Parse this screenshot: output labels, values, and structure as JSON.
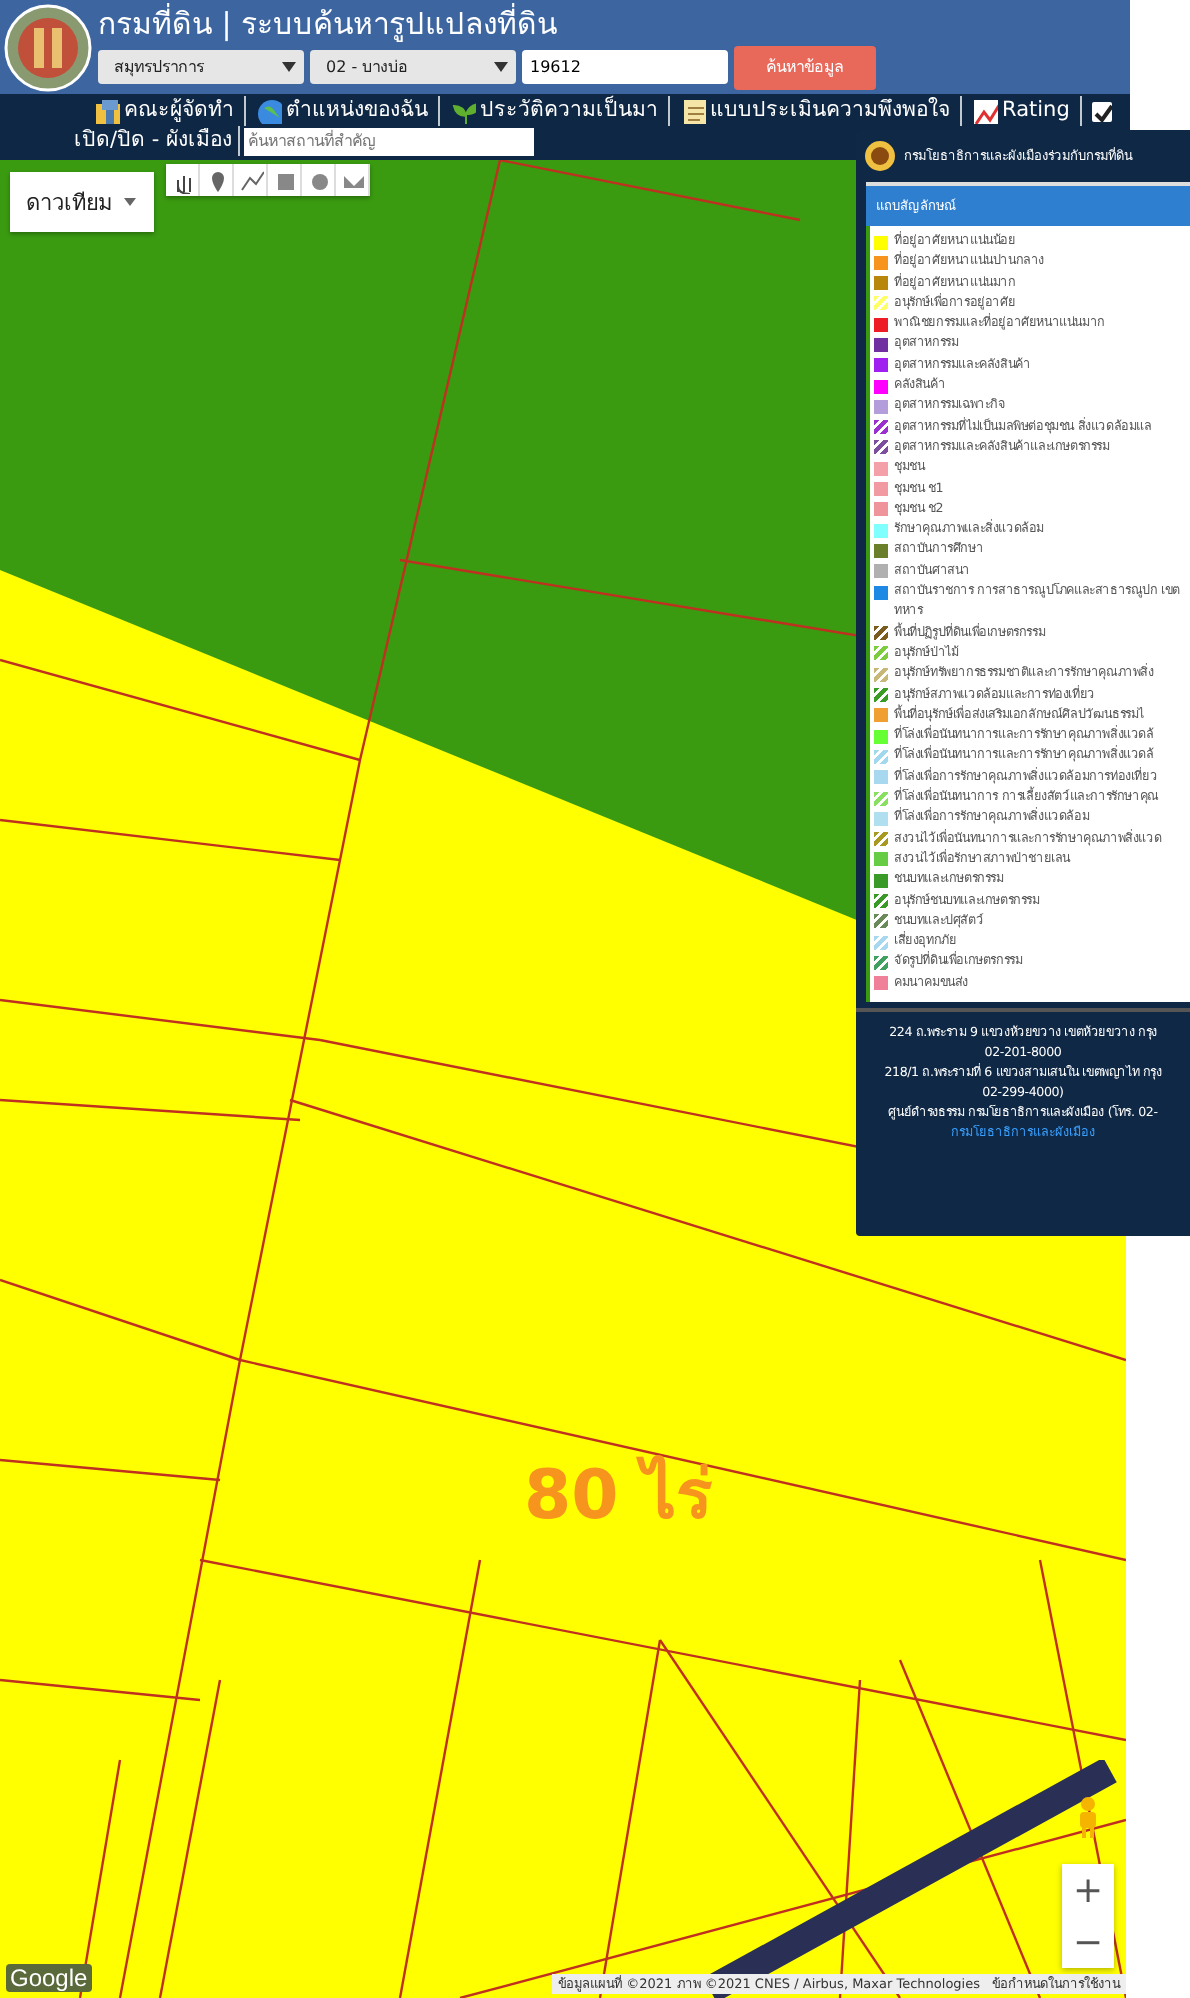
{
  "header": {
    "title": "กรมที่ดิน | ระบบค้นหารูปแปลงที่ดิน",
    "province_select": "สมุทรปราการ",
    "district_select": "02 - บางบ่อ",
    "parcel_input": "19612",
    "search_button": "ค้นหาข้อมูล"
  },
  "nav": {
    "items": [
      {
        "label": "คณะผู้จัดทำ",
        "kind": "people"
      },
      {
        "label": "ตำแหน่งของฉัน",
        "kind": "globe"
      },
      {
        "label": "ประวัติความเป็นมา",
        "kind": "sprout"
      },
      {
        "label": "แบบประเมินความพึงพอใจ",
        "kind": "note"
      },
      {
        "label": "Rating",
        "kind": "chart"
      }
    ],
    "toggle": {
      "label": "เปิด/ปิด - ผังเมือง",
      "checked": true
    },
    "place_search": {
      "placeholder": "ค้นหาสถานที่สำคัญ"
    }
  },
  "map": {
    "map_type": "ดาวเทียม",
    "area_label": "80 ไร่",
    "google_logo": "Google",
    "attribution": "ข้อมูลแผนที่ ©2021 ภาพ ©2021 CNES / Airbus, Maxar Technologies",
    "terms": "ข้อกำหนดในการใช้งาน",
    "zoom_in": "+",
    "zoom_out": "−"
  },
  "legend": {
    "title": "กรมโยธาธิการและผังเมืองร่วมกับกรมที่ดิน",
    "heading": "แถบสัญลักษณ์",
    "items": [
      {
        "label": "ที่อยู่อาศัยหนาแน่นน้อย",
        "color": "#ffff00",
        "kind": "solid"
      },
      {
        "label": "ที่อยู่อาศัยหนาแน่นปานกลาง",
        "color": "#f7941d",
        "kind": "solid"
      },
      {
        "label": "ที่อยู่อาศัยหนาแน่นมาก",
        "color": "#b8860b",
        "kind": "solid"
      },
      {
        "label": "อนุรักษ์เพื่อการอยู่อาศัย",
        "color": "#ffff66",
        "kind": "hatched"
      },
      {
        "label": "พาณิชยกรรมและที่อยู่อาศัยหนาแน่นมาก",
        "color": "#ee1c25",
        "kind": "solid"
      },
      {
        "label": "อุตสาหกรรม",
        "color": "#7030a0",
        "kind": "solid"
      },
      {
        "label": "อุตสาหกรรมและคลังสินค้า",
        "color": "#a020f0",
        "kind": "solid"
      },
      {
        "label": "คลังสินค้า",
        "color": "#ff00ff",
        "kind": "solid"
      },
      {
        "label": "อุตสาหกรรมเฉพาะกิจ",
        "color": "#b39ddb",
        "kind": "solid"
      },
      {
        "label": "อุตสาหกรรมที่ไม่เป็นมลพิษต่อชุมชน สิ่งแวดล้อมแล",
        "color": "#9b30d0",
        "kind": "hatched"
      },
      {
        "label": "อุตสาหกรรมและคลังสินค้าและเกษตรกรรม",
        "color": "#7b4f9e",
        "kind": "hatched"
      },
      {
        "label": "ชุมชน",
        "color": "#f4a0a8",
        "kind": "solid"
      },
      {
        "label": "ชุมชน ช1",
        "color": "#f29aa2",
        "kind": "solid"
      },
      {
        "label": "ชุมชน ช2",
        "color": "#f0949c",
        "kind": "solid"
      },
      {
        "label": "รักษาคุณภาพและสิ่งแวดล้อม",
        "color": "#80ffff",
        "kind": "solid"
      },
      {
        "label": "สถาบันการศึกษา",
        "color": "#6b7f2a",
        "kind": "solid"
      },
      {
        "label": "สถาบันศาสนา",
        "color": "#b0b0b0",
        "kind": "solid"
      },
      {
        "label": "สถาบันราชการ การสาธารณูปโภคและสาธารณูปก เขตทหาร",
        "color": "#1e88e5",
        "kind": "solid"
      },
      {
        "label": "พื้นที่ปฏิรูปที่ดินเพื่อเกษตรกรรม",
        "color": "#7a5c1e",
        "kind": "hatched"
      },
      {
        "label": "อนุรักษ์ป่าไม้",
        "color": "#7ccd3c",
        "kind": "hatched"
      },
      {
        "label": "อนุรักษ์ทรัพยากรธรรมชาติและการรักษาคุณภาพสิ่ง",
        "color": "#c8b878",
        "kind": "hatched"
      },
      {
        "label": "อนุรักษ์สภาพแวดล้อมและการท่องเที่ยว",
        "color": "#3a9d23",
        "kind": "hatched"
      },
      {
        "label": "พื้นที่อนุรักษ์เพื่อส่งเสริมเอกลักษณ์ศิลปวัฒนธรรมไ",
        "color": "#f0a030",
        "kind": "solid"
      },
      {
        "label": "ที่โล่งเพื่อนันทนาการและการรักษาคุณภาพสิ่งแวดล้",
        "color": "#66ff33",
        "kind": "solid"
      },
      {
        "label": "ที่โล่งเพื่อนันทนาการและการรักษาคุณภาพสิ่งแวดล้",
        "color": "#a0d8ef",
        "kind": "hatched"
      },
      {
        "label": "ที่โล่งเพื่อการรักษาคุณภาพสิ่งแวดล้อมการท่องเที่ยว",
        "color": "#a8d8f0",
        "kind": "solid"
      },
      {
        "label": "ที่โล่งเพื่อนันทนาการ การเลี้ยงสัตว์และการรักษาคุณ",
        "color": "#88e060",
        "kind": "hatched"
      },
      {
        "label": "ที่โล่งเพื่อการรักษาคุณภาพสิ่งแวดล้อม",
        "color": "#b0e0f0",
        "kind": "solid"
      },
      {
        "label": "สงวนไว้เพื่อนันทนาการและการรักษาคุณภาพสิ่งแวด",
        "color": "#a89a20",
        "kind": "hatched"
      },
      {
        "label": "สงวนไว้เพื่อรักษาสภาพป่าชายเลน",
        "color": "#66cc44",
        "kind": "solid"
      },
      {
        "label": "ชนบทและเกษตรกรรม",
        "color": "#3a9a28",
        "kind": "solid"
      },
      {
        "label": "อนุรักษ์ชนบทและเกษตรกรรม",
        "color": "#3a9a28",
        "kind": "hatched"
      },
      {
        "label": "ชนบทและปศุสัตว์",
        "color": "#6a8a5a",
        "kind": "hatched"
      },
      {
        "label": "เสี่ยงอุทกภัย",
        "color": "#a8d8f0",
        "kind": "hatched"
      },
      {
        "label": "จัดรูปที่ดินเพื่อเกษตรกรรม",
        "color": "#40a060",
        "kind": "hatched"
      },
      {
        "label": "คมนาคมขนส่ง",
        "color": "#f08098",
        "kind": "solid"
      }
    ],
    "footer": {
      "lines": [
        "224 ถ.พระราม 9 แขวงห้วยขวาง เขตห้วยขวาง กรุง",
        "02-201-8000",
        "218/1 ถ.พระรามที่ 6 แขวงสามเสนใน เขตพญาไท กรุง",
        "02-299-4000)",
        "ศูนย์ดำรงธรรม กรมโยธาธิการและผังเมือง (โทร. 02-"
      ],
      "link": "กรมโยธาธิการและผังเมือง"
    }
  }
}
